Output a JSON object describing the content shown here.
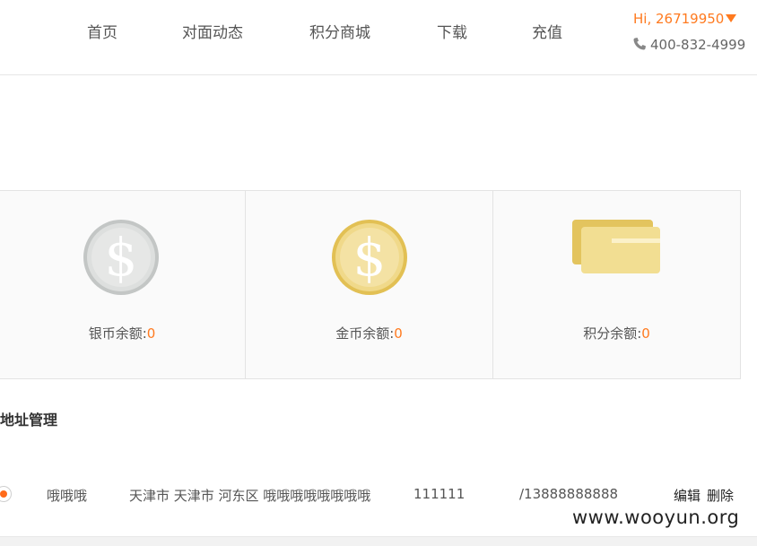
{
  "nav": {
    "items": [
      "首页",
      "对面动态",
      "积分商城",
      "下载",
      "充值"
    ]
  },
  "user": {
    "greeting": "Hi, 26719950",
    "phone": "400-832-4999"
  },
  "balances": [
    {
      "label": "银币余额:",
      "value": "0",
      "icon": "silver-coin-icon"
    },
    {
      "label": "金币余额:",
      "value": "0",
      "icon": "gold-coin-icon"
    },
    {
      "label": "积分余额:",
      "value": "0",
      "icon": "points-card-icon"
    }
  ],
  "address_section": {
    "title": "地址管理",
    "row": {
      "name": "哦哦哦",
      "address": "天津市 天津市 河东区 哦哦哦哦哦哦哦哦",
      "postcode": "111111",
      "phone": "/13888888888",
      "edit": "编辑",
      "delete": "删除"
    }
  },
  "watermark": "www.wooyun.org",
  "colors": {
    "accent": "#ff7a1f",
    "silver": "#c9cccc",
    "gold": "#e6c65a"
  }
}
